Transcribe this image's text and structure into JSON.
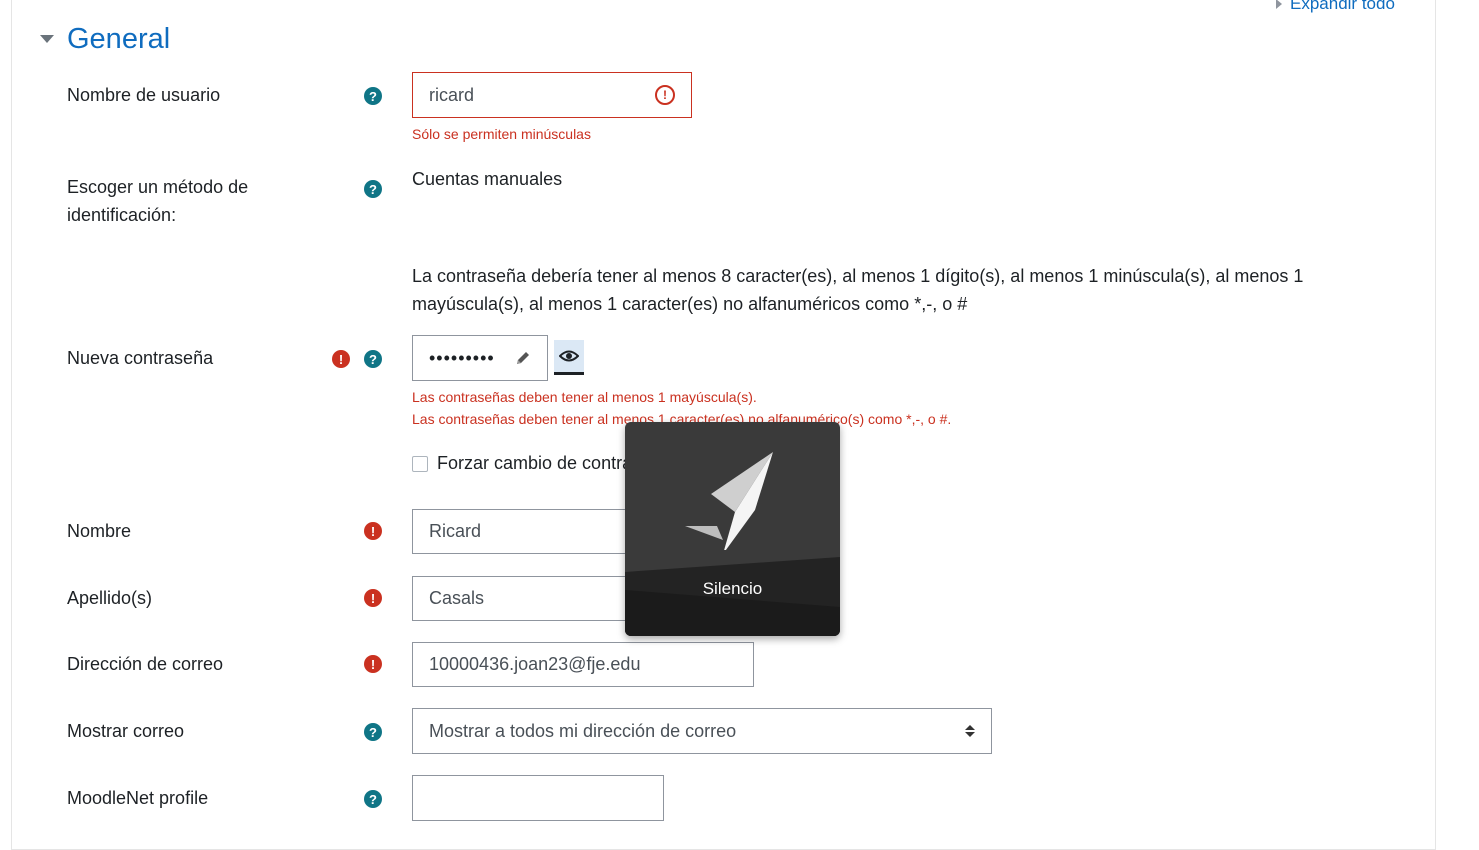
{
  "header": {
    "expand_all": "Expandir todo"
  },
  "section": {
    "title": "General"
  },
  "fields": {
    "username": {
      "label": "Nombre de usuario",
      "value": "ricard",
      "error": "Sólo se permiten minúsculas"
    },
    "auth": {
      "label_line1": "Escoger un método de",
      "label_line2": "identificación:",
      "value": "Cuentas manuales"
    },
    "password_policy": {
      "line1": "La contraseña debería tener al menos 8 caracter(es), al menos 1 dígito(s), al menos 1 minúscula(s), al menos 1",
      "line2": "mayúscula(s), al menos 1 caracter(es) no alfanuméricos como *,-, o #"
    },
    "new_password": {
      "label": "Nueva contraseña",
      "value": "•••••••••",
      "error1": "Las contraseñas deben tener al menos 1 mayúscula(s).",
      "error2": "Las contraseñas deben tener al menos 1 caracter(es) no alfanumérico(s) como *,-, o #."
    },
    "force_change": {
      "label": "Forzar cambio de contraseña"
    },
    "firstname": {
      "label": "Nombre",
      "value": "Ricard"
    },
    "lastname": {
      "label": "Apellido(s)",
      "value": "Casals"
    },
    "email": {
      "label": "Dirección de correo",
      "value": "10000436.joan23@fje.edu"
    },
    "maildisplay": {
      "label": "Mostrar correo",
      "value": "Mostrar a todos mi dirección de correo"
    },
    "moodlenet": {
      "label": "MoodleNet profile",
      "value": ""
    }
  },
  "overlay": {
    "label": "Silencio"
  },
  "colors": {
    "link": "#0f6cbf",
    "help": "#0f7586",
    "error": "#ca3120"
  }
}
